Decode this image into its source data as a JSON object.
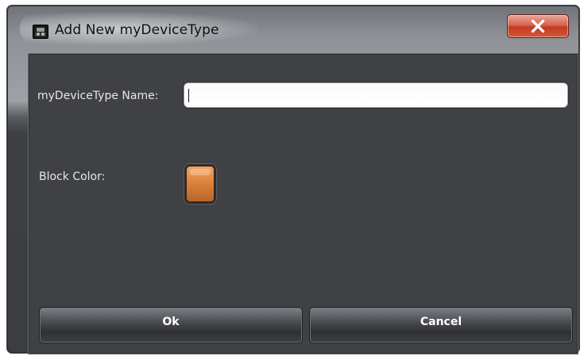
{
  "window": {
    "title": "Add New myDeviceType",
    "close_icon": "close-icon"
  },
  "form": {
    "name_label": "myDeviceType Name:",
    "name_value": "",
    "color_label": "Block Color:",
    "block_color": "#d97f3a"
  },
  "buttons": {
    "ok_label": "Ok",
    "cancel_label": "Cancel"
  }
}
